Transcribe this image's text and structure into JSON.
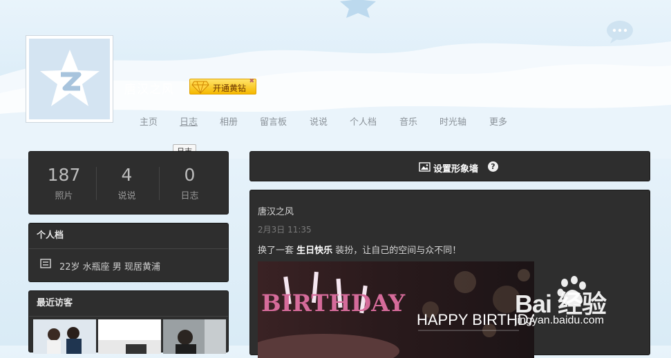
{
  "profile": {
    "username": "唐汉之风",
    "vip_label": "开通黄钻"
  },
  "nav": {
    "items": [
      {
        "label": "主页"
      },
      {
        "label": "日志",
        "active": true
      },
      {
        "label": "相册"
      },
      {
        "label": "留言板"
      },
      {
        "label": "说说"
      },
      {
        "label": "个人档"
      },
      {
        "label": "音乐"
      },
      {
        "label": "时光轴"
      },
      {
        "label": "更多"
      }
    ],
    "tooltip": "日志"
  },
  "stats": [
    {
      "value": "187",
      "label": "照片"
    },
    {
      "value": "4",
      "label": "说说"
    },
    {
      "value": "0",
      "label": "日志"
    }
  ],
  "profile_card": {
    "title": "个人档",
    "info": "22岁  水瓶座 男 现居黄浦"
  },
  "visitors": {
    "title": "最近访客"
  },
  "cover": {
    "label": "设置形象墙",
    "help": "?"
  },
  "feed": {
    "author": "唐汉之风",
    "time": "2月3日 11:35",
    "msg_prefix": "换了一套 ",
    "msg_highlight": "生日快乐",
    "msg_suffix": " 装扮，让自己的空间与众不同！",
    "image_text": "HAPPY BIRTHDAY",
    "image_cake_text": "BIRTHDAY"
  },
  "watermark": {
    "logo": "Bai  经验",
    "url": "jingyan.baidu.com"
  },
  "colors": {
    "panel_bg": "#2e2e2e",
    "sky": "#e6f2fa",
    "badge_gold": "#f5b800"
  }
}
